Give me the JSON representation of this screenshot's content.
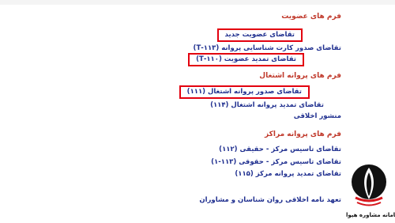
{
  "sections": {
    "membership": {
      "heading": "فرم های عضویت",
      "new_membership": "تقاضای عضویت جدید",
      "license_card": "تقاضای صدور کارت شناسایی پروانه (۱۱۳-T)",
      "renew_membership": "تقاضای تمدید عضویت (۱۱۰-T)"
    },
    "employment_license": {
      "heading": "فرم های پروانه اشتغال",
      "issue_license": "تقاضای صدور پروانه اشتغال (۱۱۱)",
      "renew_license": "تقاضای تمدید پروانه اشتغال (۱۱۴)",
      "ethics_charter": "منشور اخلاقی"
    },
    "center_license": {
      "heading": "فرم های پروانه مراکز",
      "establish_natural": "تقاضای تاسیس مرکز - حقیقی (۱۱۲)",
      "establish_legal": "تقاضای تاسیس مرکز - حقوقی (۱۱۳-۱)",
      "renew_center": "تقاضای تمدید پروانه مرکز (۱۱۵)"
    },
    "ethics_pledge": "تعهد نامه اخلاقی روان شناسان و مشاوران"
  },
  "watermark": {
    "site_name": "سامانه مشاوره هپوا"
  },
  "colors": {
    "heading": "#c0392b",
    "link": "#1f2f8f",
    "highlight_border": "#e3000f"
  }
}
